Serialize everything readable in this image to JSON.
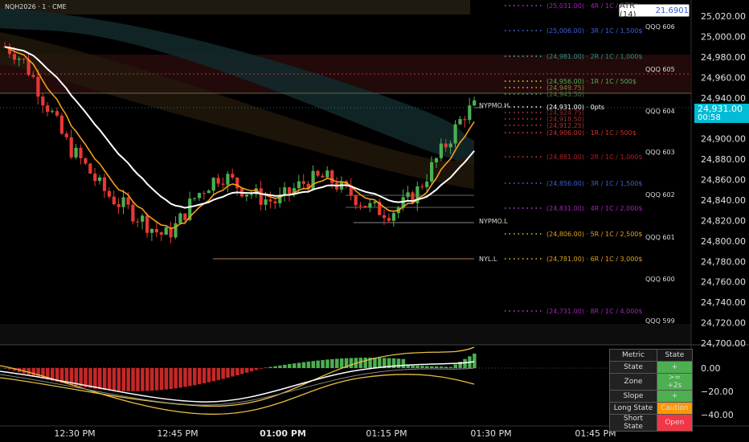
{
  "header": {
    "symbol": "NQH2026 · 1 · CME"
  },
  "atr": {
    "label": "ATR (14)",
    "value": "21.6901"
  },
  "price_scale": {
    "main": [
      "25,020.00",
      "25,000.00",
      "24,980.00",
      "24,960.00",
      "24,940.00",
      "24,920.00",
      "24,900.00",
      "24,880.00",
      "24,860.00",
      "24,840.00",
      "24,820.00",
      "24,800.00",
      "24,780.00",
      "24,760.00",
      "24,740.00",
      "24,720.00",
      "24,700.00"
    ],
    "current": "24,931.00",
    "countdown": "00:58",
    "osc": [
      "0.00",
      "−20.00",
      "−40.00"
    ]
  },
  "time_axis": [
    "12:30 PM",
    "12:45 PM",
    "01:00 PM",
    "01:15 PM",
    "01:30 PM",
    "01:45 PM"
  ],
  "target_labels": [
    {
      "text": "(25,031.00) · 4R / 1C / 2,000$",
      "color": "#9c27b0",
      "dots": "#c040e0"
    },
    {
      "text": "(25,006.00) · 3R / 1C / 1,500$",
      "color": "#3f5fd8",
      "dots": "#4a6ff0"
    },
    {
      "text": "(24,981.00) · 2R / 1C / 1,000$",
      "color": "#2a8f86",
      "dots": "#3fbfb0"
    },
    {
      "text": "(24,956.00) · 1R / 1C / 500$",
      "color": "#4caf50",
      "dots": "#e0e040"
    },
    {
      "text": "(24,949.75)",
      "color": "#7a8b3a",
      "dots": "#c0c040"
    },
    {
      "text": "(24,943.50)",
      "color": "#4a7a4a",
      "dots": "#60a060"
    },
    {
      "text": "(24,931.00) · 0pts",
      "color": "#ffffff",
      "dots": "#ffffff"
    },
    {
      "text": "(24,924.75)",
      "color": "#8a3030",
      "dots": "#b04040"
    },
    {
      "text": "(24,918.50)",
      "color": "#a03030",
      "dots": "#c04040"
    },
    {
      "text": "(24,912.25)",
      "color": "#b03030",
      "dots": "#d04040"
    },
    {
      "text": "(24,906.00) · 1R / 1C / 500$",
      "color": "#d03030",
      "dots": "#e04040"
    },
    {
      "text": "(24,881.00) · 2R / 1C / 1,000$",
      "color": "#b02020",
      "dots": "#d04040"
    },
    {
      "text": "(24,856.00) · 3R / 1C / 1,500$",
      "color": "#3f5fd8",
      "dots": "#4a6ff0"
    },
    {
      "text": "(24,831.00) · 4R / 1C / 2,000$",
      "color": "#9c27b0",
      "dots": "#c040e0"
    },
    {
      "text": "(24,806.00) · 5R / 1C / 2,500$",
      "color": "#e0a020",
      "dots": "#f0c030"
    },
    {
      "text": "(24,781.00) · 6R / 1C / 3,000$",
      "color": "#e0a020",
      "dots": "#f0c030"
    },
    {
      "text": "(24,731.00) · 8R / 1C / 4,000$",
      "color": "#9c27b0",
      "dots": "#c040e0"
    }
  ],
  "qqq_labels": [
    "QQQ 606",
    "QQQ 605",
    "QQQ 604",
    "QQQ 603",
    "QQQ 602",
    "QQQ 601",
    "QQQ 600",
    "QQQ 599"
  ],
  "level_labels": {
    "nypmo_h": "NYPMO.H",
    "nypmo_l": "NYPMO.L",
    "nyl_l": "NYL.L"
  },
  "state_table": {
    "headers": [
      "Metric",
      "State"
    ],
    "rows": [
      {
        "metric": "State",
        "state": "+",
        "color": "#4caf50"
      },
      {
        "metric": "Zone",
        "state": ">= +2s",
        "color": "#4caf50"
      },
      {
        "metric": "Slope",
        "state": "+",
        "color": "#4caf50"
      },
      {
        "metric": "Long State",
        "state": "Caution",
        "color": "#ff9800"
      },
      {
        "metric": "Short State",
        "state": "Open",
        "color": "#f23645"
      }
    ]
  },
  "colors": {
    "up": "#4caf50",
    "down": "#e53935",
    "accent": "#00bcd4",
    "ema_fast": "#f59e1b",
    "ema_slow": "#ffffff"
  }
}
